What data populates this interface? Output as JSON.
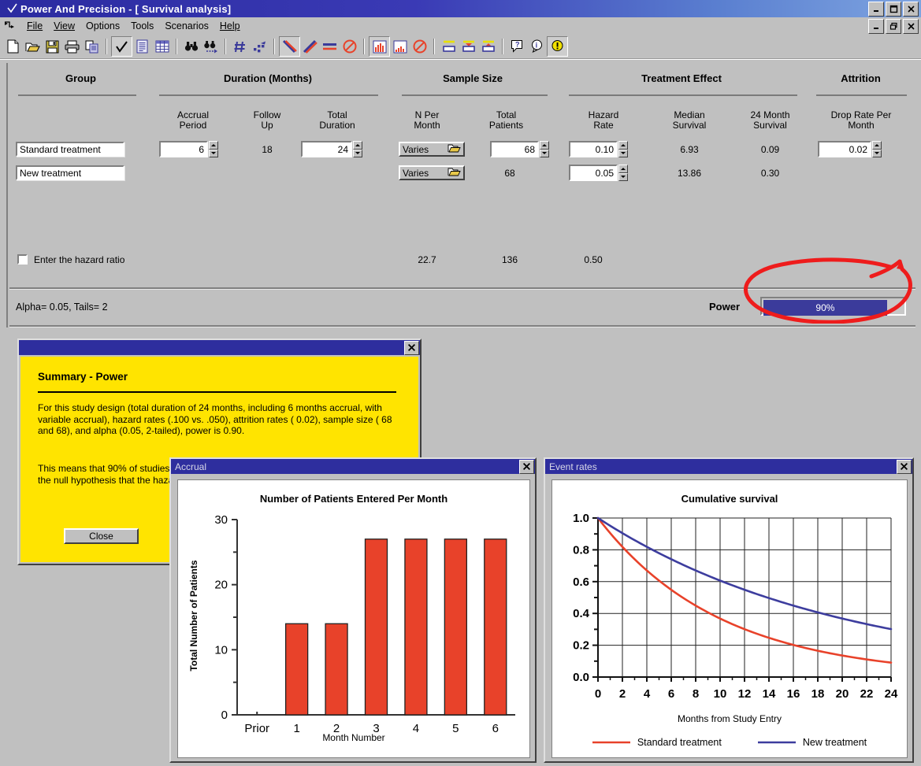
{
  "app": {
    "title": "Power And Precision - [ Survival analysis]",
    "title_check_icon": "check-icon",
    "window_buttons": [
      "minimize",
      "maximize",
      "close"
    ],
    "mdi_buttons": [
      "minimize",
      "restore",
      "close"
    ]
  },
  "menu": {
    "items": [
      "File",
      "View",
      "Options",
      "Tools",
      "Scenarios",
      "Help"
    ]
  },
  "toolbar": {
    "groups": [
      [
        "new-document-icon",
        "open-folder-icon",
        "save-disk-icon",
        "print-icon",
        "copy-icon"
      ],
      [
        "checkmark-icon",
        "report-page-icon",
        "table-grid-icon"
      ],
      [
        "binoculars-icon",
        "binoculars-next-icon"
      ],
      [
        "number-sign-icon",
        "scatter-points-icon"
      ],
      [
        "line-descending-icon",
        "line-ascending-icon",
        "line-flat-icon",
        "no-line-icon"
      ],
      [
        "bar-chart-icon",
        "bar-chart-small-icon",
        "no-chart-icon"
      ],
      [
        "box-plain-icon",
        "box-down-icon",
        "box-up-icon"
      ],
      [
        "help-question-icon",
        "info-icon",
        "warning-icon"
      ]
    ]
  },
  "form": {
    "sections": {
      "group": "Group",
      "duration": "Duration (Months)",
      "sample_size": "Sample Size",
      "treatment_effect": "Treatment Effect",
      "attrition": "Attrition"
    },
    "columns": {
      "accrual_period": "Accrual\nPeriod",
      "accrual_period_l1": "Accrual",
      "accrual_period_l2": "Period",
      "follow_up_l1": "Follow",
      "follow_up_l2": "Up",
      "total_duration_l1": "Total",
      "total_duration_l2": "Duration",
      "n_per_month_l1": "N Per",
      "n_per_month_l2": "Month",
      "total_patients_l1": "Total",
      "total_patients_l2": "Patients",
      "hazard_rate_l1": "Hazard",
      "hazard_rate_l2": "Rate",
      "median_survival_l1": "Median",
      "median_survival_l2": "Survival",
      "month24_survival_l1": "24 Month",
      "month24_survival_l2": "Survival",
      "drop_rate_l1": "Drop Rate Per",
      "drop_rate_l2": "Month"
    },
    "rows": [
      {
        "group": "Standard treatment",
        "accrual_period": "6",
        "follow_up": "18",
        "total_duration": "24",
        "n_per_month": "Varies",
        "total_patients": "68",
        "hazard_rate": "0.10",
        "median_survival": "6.93",
        "month24_survival": "0.09",
        "drop_rate": "0.02"
      },
      {
        "group": "New treatment",
        "n_per_month": "Varies",
        "total_patients": "68",
        "hazard_rate": "0.05",
        "median_survival": "13.86",
        "month24_survival": "0.30"
      }
    ],
    "totals": {
      "n_per_month": "22.7",
      "total_patients": "136",
      "hazard_rate": "0.50"
    },
    "hazard_ratio_checkbox": {
      "label": "Enter the hazard ratio",
      "checked": false
    },
    "alpha_tails": "Alpha= 0.05, Tails= 2",
    "power_label": "Power",
    "power_value": "90%",
    "power_percent": 90
  },
  "summary_window": {
    "title": "",
    "heading": "Summary - Power",
    "paragraph1": "For this study design (total duration of 24 months, including 6 months accrual, with variable accrual),  hazard rates (.100 vs. .050),  attrition rates ( 0.02), sample size ( 68 and  68), and alpha (0.05, 2-tailed), power is 0.90.",
    "paragraph2": "This means that 90% of studies would be expected to yield a significant effect, rejecting the null hypothesis that the hazard rates are equal.",
    "close_label": "Close",
    "close_icon": "close-icon"
  },
  "accrual_window": {
    "title": "Accrual",
    "close_icon": "close-icon"
  },
  "events_window": {
    "title": "Event rates",
    "close_icon": "close-icon"
  },
  "colors": {
    "standard_treatment": "#e8422a",
    "new_treatment": "#3d3d9e",
    "titlebar": "#2e2e9e",
    "summary_background": "#ffe400",
    "power_fill": "#3b3b9b",
    "annotation": "#ee1c1c",
    "window_face": "#c0c0c0"
  },
  "annotation": {
    "shape": "hand-drawn-red-ellipse",
    "target": "power-bar"
  },
  "chart_data": [
    {
      "type": "bar",
      "title": "Number of Patients Entered Per Month",
      "xlabel": "Month Number",
      "ylabel": "Total Number of Patients",
      "categories": [
        "Prior",
        "1",
        "2",
        "3",
        "4",
        "5",
        "6"
      ],
      "values": [
        0,
        14,
        14,
        27,
        27,
        27,
        27
      ],
      "ylim": [
        0,
        30
      ],
      "yticks": [
        0,
        10,
        20,
        30
      ],
      "yminorticks": [
        5,
        15,
        25
      ],
      "grid": false,
      "bar_color": "#e8422a",
      "legend": null
    },
    {
      "type": "line",
      "title": "Cumulative survival",
      "xlabel": "Months from Study Entry",
      "ylabel": "",
      "xlim": [
        0,
        24
      ],
      "ylim": [
        0,
        1.0
      ],
      "xticks": [
        0,
        2,
        4,
        6,
        8,
        10,
        12,
        14,
        16,
        18,
        20,
        22,
        24
      ],
      "yticks": [
        0.0,
        0.2,
        0.4,
        0.6,
        0.8,
        1.0
      ],
      "grid": true,
      "legend_position": "bottom",
      "series": [
        {
          "name": "Standard treatment",
          "color": "#e8422a",
          "x": [
            0,
            2,
            4,
            6,
            8,
            10,
            12,
            14,
            16,
            18,
            20,
            22,
            24
          ],
          "values": [
            1.0,
            0.82,
            0.67,
            0.55,
            0.45,
            0.37,
            0.3,
            0.25,
            0.2,
            0.17,
            0.14,
            0.12,
            0.09
          ]
        },
        {
          "name": "New treatment",
          "color": "#3d3d9e",
          "x": [
            0,
            2,
            4,
            6,
            8,
            10,
            12,
            14,
            16,
            18,
            20,
            22,
            24
          ],
          "values": [
            1.0,
            0.9,
            0.82,
            0.74,
            0.67,
            0.61,
            0.55,
            0.5,
            0.45,
            0.41,
            0.37,
            0.33,
            0.3
          ]
        }
      ]
    }
  ]
}
